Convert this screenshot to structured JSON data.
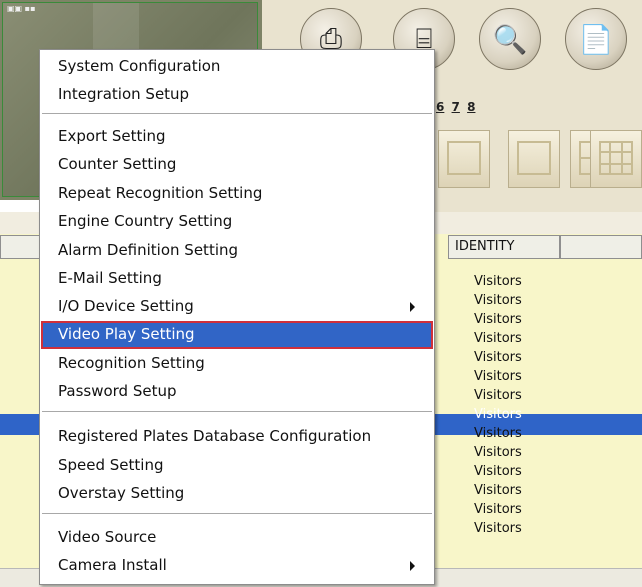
{
  "toolbar": {
    "numbers": [
      "6",
      "7",
      "8"
    ]
  },
  "list": {
    "columns": [
      "IDENTITY"
    ],
    "identity_values": [
      "Visitors",
      "Visitors",
      "Visitors",
      "Visitors",
      "Visitors",
      "Visitors",
      "Visitors",
      "Visitors",
      "Visitors",
      "Visitors",
      "Visitors",
      "Visitors",
      "Visitors",
      "Visitors"
    ],
    "selected_index": 7
  },
  "menu": {
    "items": [
      {
        "label": "System Configuration"
      },
      {
        "label": "Integration Setup"
      },
      {
        "label": "Export Setting"
      },
      {
        "label": "Counter Setting"
      },
      {
        "label": "Repeat Recognition Setting"
      },
      {
        "label": "Engine Country Setting"
      },
      {
        "label": "Alarm Definition Setting"
      },
      {
        "label": "E-Mail Setting"
      },
      {
        "label": "I/O Device Setting",
        "submenu": true
      },
      {
        "label": "Video Play Setting",
        "highlighted": true
      },
      {
        "label": "Recognition Setting"
      },
      {
        "label": "Password Setup"
      },
      {
        "label": "Registered Plates Database Configuration"
      },
      {
        "label": "Speed Setting"
      },
      {
        "label": "Overstay Setting"
      },
      {
        "label": "Video Source"
      },
      {
        "label": "Camera Install",
        "submenu": true
      }
    ]
  },
  "colors": {
    "highlight": "#3165c6",
    "highlight_border": "#d0303a",
    "list_background": "#f8f6c9"
  }
}
